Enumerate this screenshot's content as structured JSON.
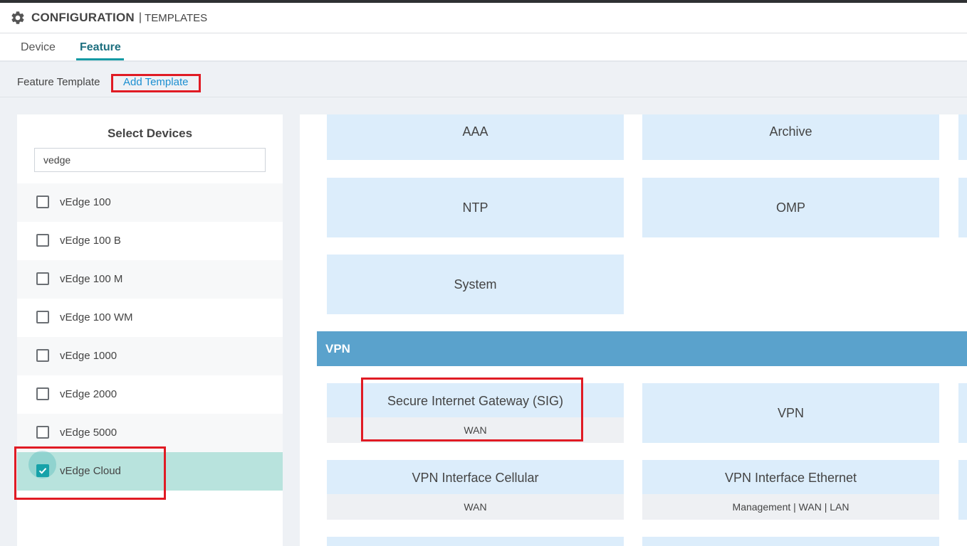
{
  "header": {
    "title": "CONFIGURATION",
    "separator": "|",
    "subtitle": "TEMPLATES"
  },
  "tabs": {
    "device": "Device",
    "feature": "Feature",
    "active": "Feature"
  },
  "subbar": {
    "breadcrumb": "Feature Template",
    "add_template": "Add Template"
  },
  "left_panel": {
    "title": "Select Devices",
    "search_value": "vedge",
    "devices": [
      {
        "label": "vEdge 100",
        "checked": false
      },
      {
        "label": "vEdge 100 B",
        "checked": false
      },
      {
        "label": "vEdge 100 M",
        "checked": false
      },
      {
        "label": "vEdge 100 WM",
        "checked": false
      },
      {
        "label": "vEdge 1000",
        "checked": false
      },
      {
        "label": "vEdge 2000",
        "checked": false
      },
      {
        "label": "vEdge 5000",
        "checked": false
      },
      {
        "label": "vEdge Cloud",
        "checked": true
      }
    ]
  },
  "templates": {
    "basic": [
      "AAA",
      "Archive",
      "NTP",
      "OMP",
      "System"
    ],
    "vpn_section": "VPN",
    "vpn": [
      {
        "name": "Secure Internet Gateway (SIG)",
        "tag": "WAN"
      },
      {
        "name": "VPN"
      },
      {
        "name": "VPN Interface Cellular",
        "tag": "WAN"
      },
      {
        "name": "VPN Interface Ethernet",
        "tag": "Management | WAN | LAN"
      }
    ]
  },
  "colors": {
    "accent": "#16a2a9",
    "link": "#1b8fd1",
    "card": "#dcedfb",
    "section": "#5aa2cc",
    "highlight": "#e01b24"
  }
}
